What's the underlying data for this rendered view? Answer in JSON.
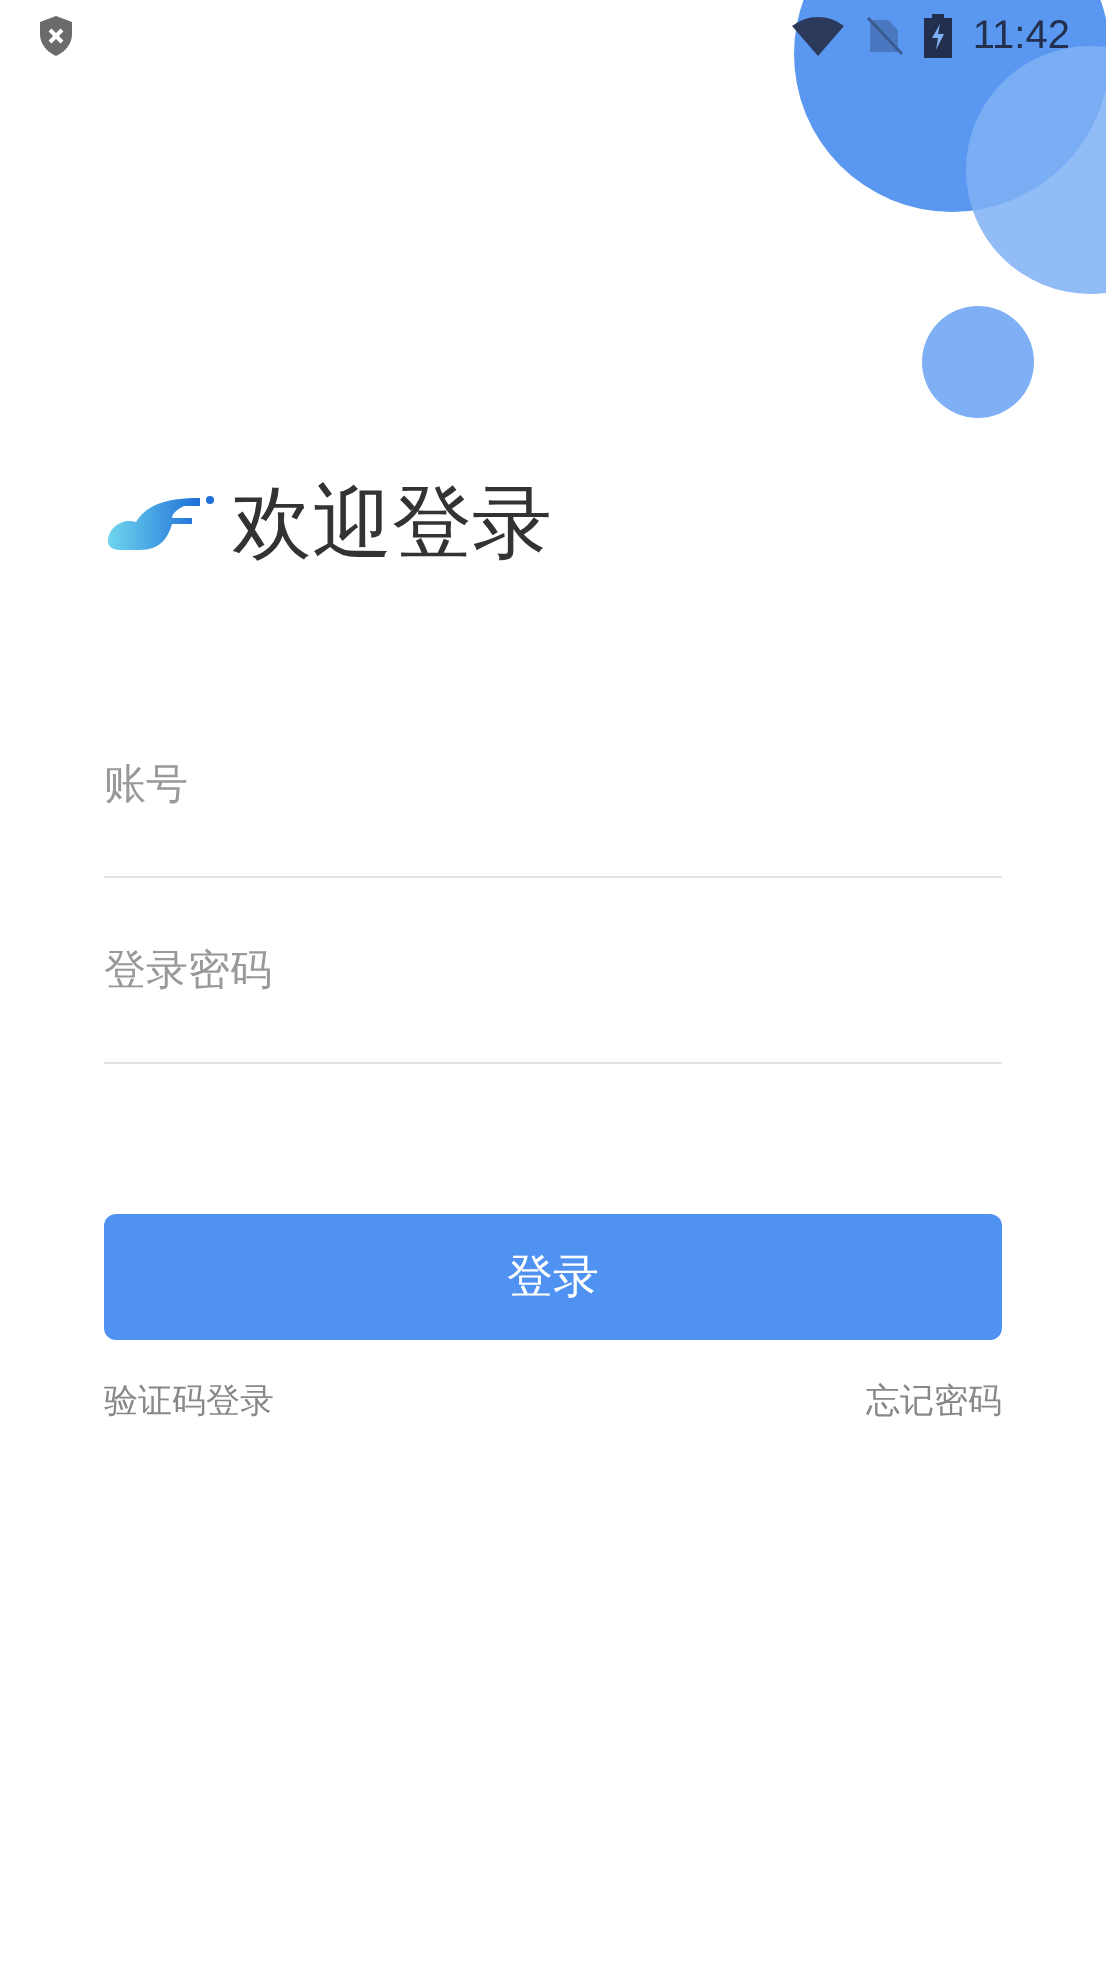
{
  "status_bar": {
    "time": "11:42"
  },
  "title": "欢迎登录",
  "fields": [
    {
      "placeholder": "账号"
    },
    {
      "placeholder": "登录密码"
    }
  ],
  "login_button": "登录",
  "links": [
    "验证码登录",
    "忘记密码"
  ]
}
